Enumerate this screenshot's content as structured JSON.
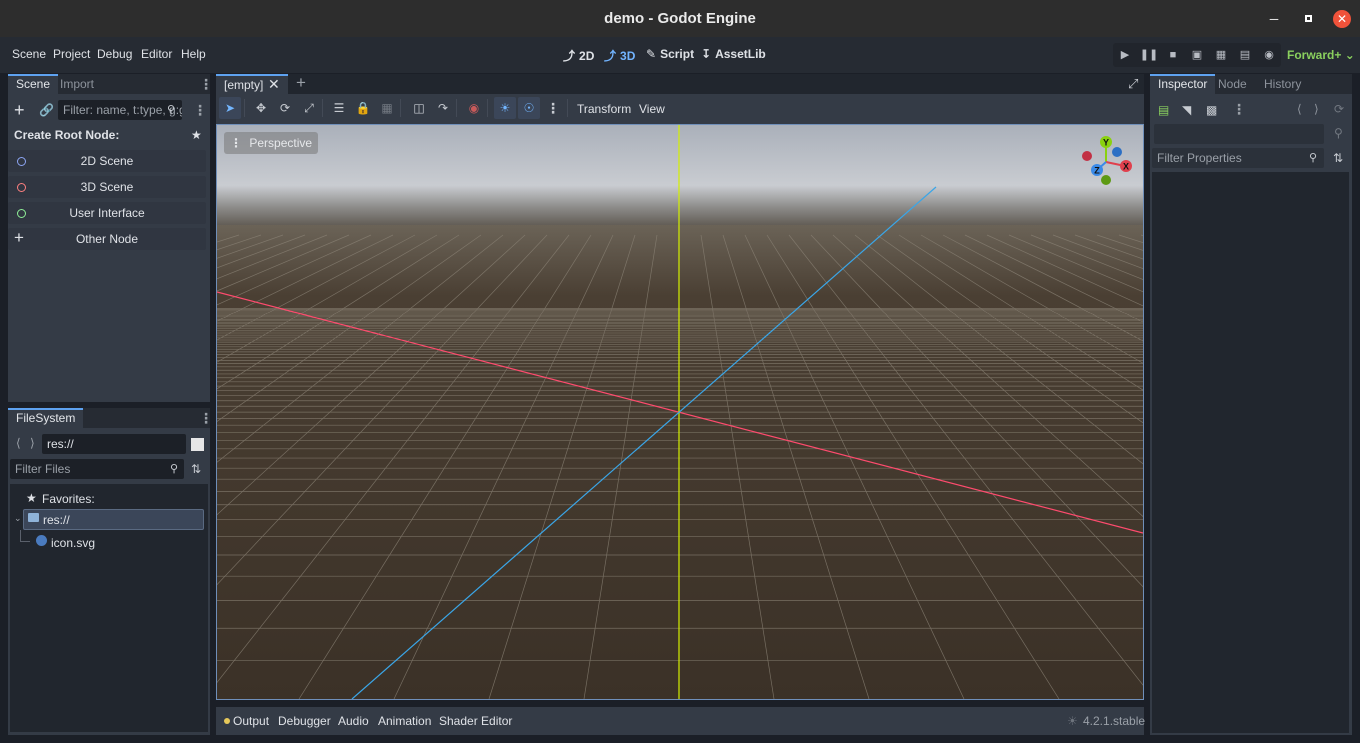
{
  "window": {
    "title": "demo - Godot Engine"
  },
  "menus": [
    "Scene",
    "Project",
    "Debug",
    "Editor",
    "Help"
  ],
  "workspaces": [
    {
      "label": "2D",
      "icon": "2d-icon"
    },
    {
      "label": "3D",
      "icon": "3d-icon",
      "active": true
    },
    {
      "label": "Script",
      "icon": "script-icon"
    },
    {
      "label": "AssetLib",
      "icon": "assetlib-icon"
    }
  ],
  "renderer": "Forward+",
  "scene_dock": {
    "tabs": [
      "Scene",
      "Import"
    ],
    "filter_placeholder": "Filter: name, t:type, g:group",
    "create_root_label": "Create Root Node:",
    "root_nodes": [
      {
        "label": "2D Scene",
        "color": "#8da5f3"
      },
      {
        "label": "3D Scene",
        "color": "#fc7f7f"
      },
      {
        "label": "User Interface",
        "color": "#8eef97"
      },
      {
        "label": "Other Node",
        "color": "#dfe2e7"
      }
    ]
  },
  "filesystem": {
    "tab": "FileSystem",
    "path": "res://",
    "filter_placeholder": "Filter Files",
    "favorites_label": "Favorites:",
    "tree": [
      {
        "label": "res://",
        "icon": "folder-icon",
        "selected": true
      },
      {
        "label": "icon.svg",
        "icon": "svg-file-icon"
      }
    ]
  },
  "editor": {
    "scene_tab": "[empty]",
    "toolbar_menus": [
      "Transform",
      "View"
    ],
    "viewport_label": "Perspective",
    "gizmo": {
      "x": "X",
      "y": "Y",
      "z": "Z"
    }
  },
  "bottom_panel": {
    "tabs": [
      "Output",
      "Debugger",
      "Audio",
      "Animation",
      "Shader Editor"
    ],
    "version": "4.2.1.stable"
  },
  "inspector": {
    "tabs": [
      "Inspector",
      "Node",
      "History"
    ],
    "filter_placeholder": "Filter Properties"
  },
  "colors": {
    "accent": "#5ea2f0",
    "x_axis": "#ff4b6e",
    "y_axis": "#d4f000",
    "z_axis": "#3aa6e8",
    "ground": "#3b3127"
  }
}
